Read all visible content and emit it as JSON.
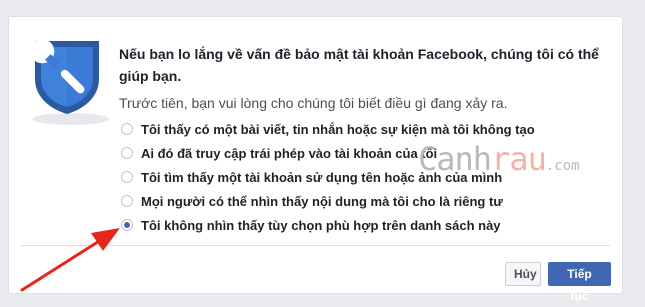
{
  "dialog": {
    "title": "Nếu bạn lo lắng về vấn đề bảo mật tài khoản Facebook, chúng tôi có thể giúp bạn.",
    "subtitle": "Trước tiên, bạn vui lòng cho chúng tôi biết điều gì đang xảy ra.",
    "options": [
      {
        "label": "Tôi thấy có một bài viết, tin nhắn hoặc sự kiện mà tôi không tạo",
        "checked": false
      },
      {
        "label": "Ai đó đã truy cập trái phép vào tài khoản của tôi",
        "checked": false
      },
      {
        "label": "Tôi tìm thấy một tài khoản sử dụng tên hoặc ảnh của mình",
        "checked": false
      },
      {
        "label": "Mọi người có thể nhìn thấy nội dung mà tôi cho là riêng tư",
        "checked": false
      },
      {
        "label": "Tôi không nhìn thấy tùy chọn phù hợp trên danh sách này",
        "checked": true
      }
    ],
    "buttons": {
      "cancel": "Hủy",
      "continue": "Tiếp tục"
    }
  },
  "watermark": {
    "part1": "Canh",
    "part2": "rau",
    "part3": ".com"
  },
  "icons": {
    "shield": "shield-wrench-icon",
    "arrow": "red-arrow-icon"
  },
  "colors": {
    "accent": "#4267b2",
    "shield_dark": "#2c5aa0",
    "shield_light": "#3b7bd5",
    "arrow": "#e8251c",
    "page_bg": "#e9ebee"
  }
}
